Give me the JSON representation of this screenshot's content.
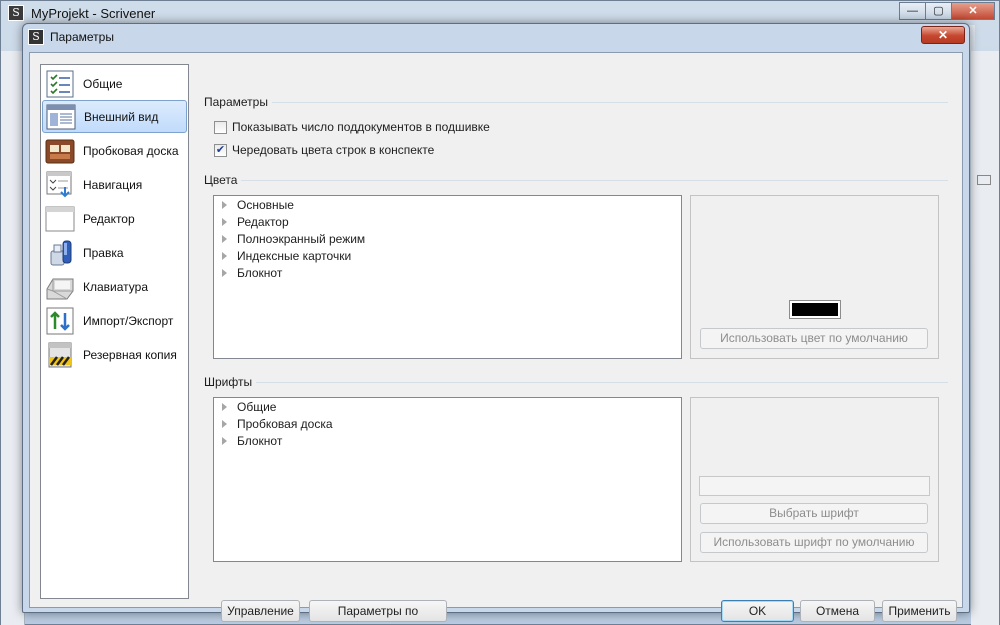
{
  "main_window": {
    "title": "MyProjekt - Scrivener",
    "buttons": {
      "minimize": "—",
      "maximize": "▢",
      "close": "✕"
    }
  },
  "dialog": {
    "title": "Параметры",
    "close": "✕",
    "sidebar": {
      "items": [
        {
          "label": "Общие",
          "icon": "checklist-icon",
          "selected": false
        },
        {
          "label": "Внешний вид",
          "icon": "appearance-window-icon",
          "selected": true
        },
        {
          "label": "Пробковая доска",
          "icon": "corkboard-icon",
          "selected": false
        },
        {
          "label": "Навигация",
          "icon": "navigation-icon",
          "selected": false
        },
        {
          "label": "Редактор",
          "icon": "editor-window-icon",
          "selected": false
        },
        {
          "label": "Правка",
          "icon": "edit-bottle-icon",
          "selected": false
        },
        {
          "label": "Клавиатура",
          "icon": "keyboard-key-icon",
          "selected": false
        },
        {
          "label": "Импорт/Экспорт",
          "icon": "import-export-arrows-icon",
          "selected": false
        },
        {
          "label": "Резервная копия",
          "icon": "backup-box-icon",
          "selected": false
        }
      ]
    },
    "params": {
      "header": "Параметры",
      "options": [
        {
          "label": "Показывать число поддокументов в подшивке",
          "checked": false
        },
        {
          "label": "Чередовать цвета строк в конспекте",
          "checked": true
        }
      ]
    },
    "colors": {
      "header": "Цвета",
      "items": [
        "Основные",
        "Редактор",
        "Полноэкранный режим",
        "Индексные карточки",
        "Блокнот"
      ],
      "swatch_color": "#000000",
      "default_button": "Использовать цвет по умолчанию"
    },
    "fonts": {
      "header": "Шрифты",
      "items": [
        "Общие",
        "Пробковая доска",
        "Блокнот"
      ],
      "choose_button": "Выбрать шрифт",
      "default_button": "Использовать шрифт по умолчанию"
    },
    "footer": {
      "manage": "Управление",
      "defaults": "Параметры по умолчанию",
      "ok": "OK",
      "cancel": "Отмена",
      "apply": "Применить"
    }
  }
}
